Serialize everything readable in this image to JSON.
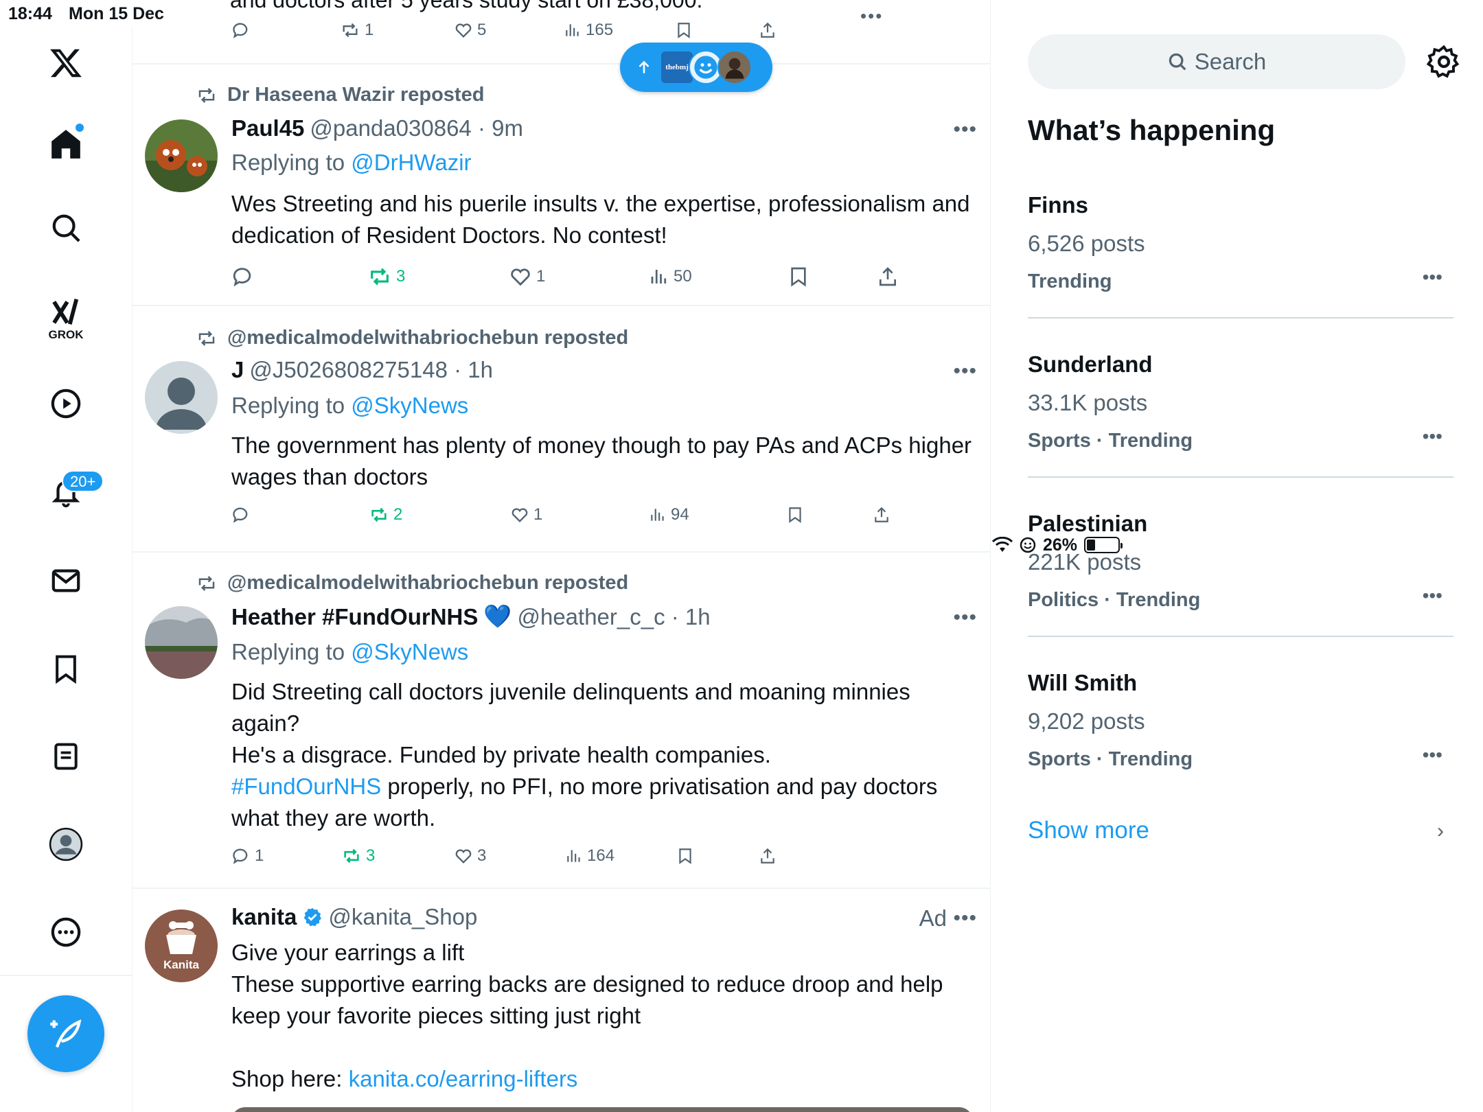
{
  "status": {
    "time": "18:44",
    "date": "Mon 15 Dec",
    "battery": "26%",
    "battery_level": 0.26
  },
  "nav": {
    "grok_label": "GROK",
    "notifications_badge": "20+"
  },
  "new_posts_pill": {
    "bmj_label": "thebmj"
  },
  "top_partial": {
    "text": "and doctors after 5 years study start on £38,000.",
    "replies": "",
    "reposts": "1",
    "likes": "5",
    "views": "165"
  },
  "tweets": [
    {
      "reposted_by": "Dr Haseena Wazir reposted",
      "name": "Paul45",
      "handle": "@panda030864 · 9m",
      "replying_prefix": "Replying to ",
      "replying_to": "@DrHWazir",
      "text": "Wes Streeting and his puerile insults v. the expertise, professionalism and dedication of Resident Doctors. No contest!",
      "replies": "",
      "reposts": "3",
      "likes": "1",
      "views": "50"
    },
    {
      "reposted_by": "@medicalmodelwithabriochebun reposted",
      "name": "J",
      "handle": "@J5026808275148 · 1h",
      "replying_prefix": "Replying to ",
      "replying_to": "@SkyNews",
      "text": "The government has plenty of money though to pay PAs and ACPs higher wages than doctors",
      "replies": "",
      "reposts": "2",
      "likes": "1",
      "views": "94"
    },
    {
      "reposted_by": "@medicalmodelwithabriochebun reposted",
      "name": "Heather #FundOurNHS",
      "emoji": "💙",
      "handle": "@heather_c_c · 1h",
      "replying_prefix": "Replying to ",
      "replying_to": "@SkyNews",
      "text_line1": "Did Streeting call doctors juvenile delinquents and moaning minnies again?",
      "text_line2": "He's a disgrace. Funded by private health companies.",
      "hashtag": "#FundOurNHS",
      "text_line3": " properly, no PFI, no more privatisation and pay doctors what they are worth.",
      "replies": "1",
      "reposts": "3",
      "likes": "3",
      "views": "164"
    }
  ],
  "ad": {
    "name": "kanita",
    "handle": "@kanita_Shop",
    "ad_label": "Ad",
    "avatar_label": "Kanita",
    "line1": "Give your earrings a lift",
    "line2": "These supportive earring backs are designed to reduce droop and help keep your favorite pieces sitting just right",
    "shop_prefix": "Shop here: ",
    "shop_link": "kanita.co/earring-lifters"
  },
  "sidebar": {
    "search_placeholder": "Search",
    "title": "What’s happening",
    "trends": [
      {
        "name": "Finns",
        "posts": "6,526 posts",
        "meta": "Trending"
      },
      {
        "name": "Sunderland",
        "posts": "33.1K posts",
        "meta": "Sports · Trending"
      },
      {
        "name": "Palestinian",
        "posts": "221K posts",
        "meta": "Politics · Trending"
      },
      {
        "name": "Will Smith",
        "posts": "9,202 posts",
        "meta": "Sports · Trending"
      }
    ],
    "show_more": "Show more"
  },
  "colors": {
    "accent": "#1d9bf0",
    "repost_green": "#00ba7c",
    "muted": "#536471",
    "text": "#0f1419"
  }
}
